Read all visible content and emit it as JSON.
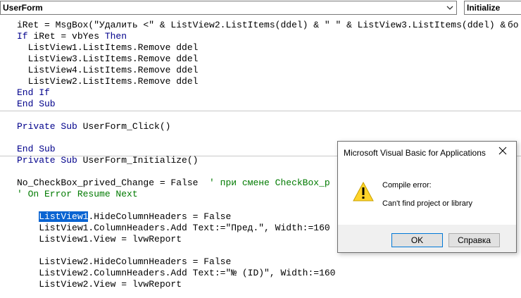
{
  "toolbar": {
    "object_selector": "UserForm",
    "procedure_selector": "Initialize"
  },
  "code": {
    "lines": [
      "iRet = MsgBox(\"Удалить <\" & ListView2.ListItems(ddel) & \" \" & ListView3.ListItems(ddel) &",
      "If iRet = vbYes Then",
      "  ListView1.ListItems.Remove ddel",
      "  ListView3.ListItems.Remove ddel",
      "  ListView4.ListItems.Remove ddel",
      "  ListView2.ListItems.Remove ddel",
      "End If",
      "End Sub",
      "",
      "Private Sub UserForm_Click()",
      "",
      "End Sub",
      "Private Sub UserForm_Initialize()",
      "",
      "No_CheckBox_prived_Change = False  ' при смене CheckBox_p",
      "' On Error Resume Next",
      "",
      "    ListView1.HideColumnHeaders = False",
      "    ListView1.ColumnHeaders.Add Text:=\"Пред.\", Width:=160",
      "    ListView1.View = lvwReport",
      "",
      "    ListView2.HideColumnHeaders = False",
      "    ListView2.ColumnHeaders.Add Text:=\"№ (ID)\", Width:=160",
      "    ListView2.View = lvwReport"
    ],
    "right_edge_fragment": "бо",
    "selected_word": "ListView1",
    "line17_rest": ".HideColumnHeaders = False",
    "line14_code": "No_CheckBox_prived_Change = False  ",
    "line14_comment": "' при смене CheckBox_p"
  },
  "dialog": {
    "title": "Microsoft Visual Basic for Applications",
    "heading": "Compile error:",
    "message": "Can't find project or library",
    "ok_label": "OK",
    "help_label": "Справка",
    "icon": "warning-icon"
  },
  "colors": {
    "keyword": "#00008b",
    "comment": "#007a00",
    "selection": "#0a64d2"
  }
}
